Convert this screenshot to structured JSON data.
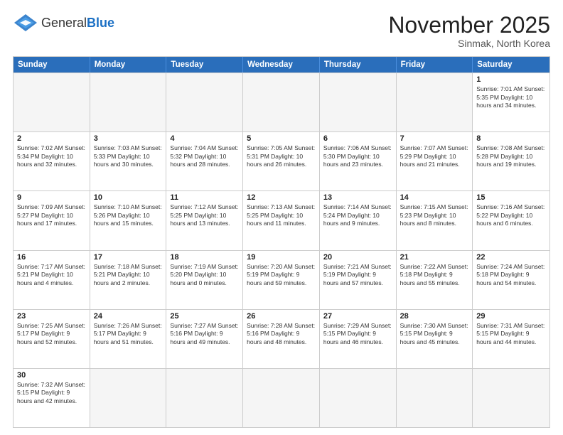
{
  "header": {
    "logo_general": "General",
    "logo_blue": "Blue",
    "month_title": "November 2025",
    "location": "Sinmak, North Korea"
  },
  "days": [
    "Sunday",
    "Monday",
    "Tuesday",
    "Wednesday",
    "Thursday",
    "Friday",
    "Saturday"
  ],
  "weeks": [
    [
      {
        "day": "",
        "info": ""
      },
      {
        "day": "",
        "info": ""
      },
      {
        "day": "",
        "info": ""
      },
      {
        "day": "",
        "info": ""
      },
      {
        "day": "",
        "info": ""
      },
      {
        "day": "",
        "info": ""
      },
      {
        "day": "1",
        "info": "Sunrise: 7:01 AM\nSunset: 5:35 PM\nDaylight: 10 hours and 34 minutes."
      }
    ],
    [
      {
        "day": "2",
        "info": "Sunrise: 7:02 AM\nSunset: 5:34 PM\nDaylight: 10 hours and 32 minutes."
      },
      {
        "day": "3",
        "info": "Sunrise: 7:03 AM\nSunset: 5:33 PM\nDaylight: 10 hours and 30 minutes."
      },
      {
        "day": "4",
        "info": "Sunrise: 7:04 AM\nSunset: 5:32 PM\nDaylight: 10 hours and 28 minutes."
      },
      {
        "day": "5",
        "info": "Sunrise: 7:05 AM\nSunset: 5:31 PM\nDaylight: 10 hours and 26 minutes."
      },
      {
        "day": "6",
        "info": "Sunrise: 7:06 AM\nSunset: 5:30 PM\nDaylight: 10 hours and 23 minutes."
      },
      {
        "day": "7",
        "info": "Sunrise: 7:07 AM\nSunset: 5:29 PM\nDaylight: 10 hours and 21 minutes."
      },
      {
        "day": "8",
        "info": "Sunrise: 7:08 AM\nSunset: 5:28 PM\nDaylight: 10 hours and 19 minutes."
      }
    ],
    [
      {
        "day": "9",
        "info": "Sunrise: 7:09 AM\nSunset: 5:27 PM\nDaylight: 10 hours and 17 minutes."
      },
      {
        "day": "10",
        "info": "Sunrise: 7:10 AM\nSunset: 5:26 PM\nDaylight: 10 hours and 15 minutes."
      },
      {
        "day": "11",
        "info": "Sunrise: 7:12 AM\nSunset: 5:25 PM\nDaylight: 10 hours and 13 minutes."
      },
      {
        "day": "12",
        "info": "Sunrise: 7:13 AM\nSunset: 5:25 PM\nDaylight: 10 hours and 11 minutes."
      },
      {
        "day": "13",
        "info": "Sunrise: 7:14 AM\nSunset: 5:24 PM\nDaylight: 10 hours and 9 minutes."
      },
      {
        "day": "14",
        "info": "Sunrise: 7:15 AM\nSunset: 5:23 PM\nDaylight: 10 hours and 8 minutes."
      },
      {
        "day": "15",
        "info": "Sunrise: 7:16 AM\nSunset: 5:22 PM\nDaylight: 10 hours and 6 minutes."
      }
    ],
    [
      {
        "day": "16",
        "info": "Sunrise: 7:17 AM\nSunset: 5:21 PM\nDaylight: 10 hours and 4 minutes."
      },
      {
        "day": "17",
        "info": "Sunrise: 7:18 AM\nSunset: 5:21 PM\nDaylight: 10 hours and 2 minutes."
      },
      {
        "day": "18",
        "info": "Sunrise: 7:19 AM\nSunset: 5:20 PM\nDaylight: 10 hours and 0 minutes."
      },
      {
        "day": "19",
        "info": "Sunrise: 7:20 AM\nSunset: 5:19 PM\nDaylight: 9 hours and 59 minutes."
      },
      {
        "day": "20",
        "info": "Sunrise: 7:21 AM\nSunset: 5:19 PM\nDaylight: 9 hours and 57 minutes."
      },
      {
        "day": "21",
        "info": "Sunrise: 7:22 AM\nSunset: 5:18 PM\nDaylight: 9 hours and 55 minutes."
      },
      {
        "day": "22",
        "info": "Sunrise: 7:24 AM\nSunset: 5:18 PM\nDaylight: 9 hours and 54 minutes."
      }
    ],
    [
      {
        "day": "23",
        "info": "Sunrise: 7:25 AM\nSunset: 5:17 PM\nDaylight: 9 hours and 52 minutes."
      },
      {
        "day": "24",
        "info": "Sunrise: 7:26 AM\nSunset: 5:17 PM\nDaylight: 9 hours and 51 minutes."
      },
      {
        "day": "25",
        "info": "Sunrise: 7:27 AM\nSunset: 5:16 PM\nDaylight: 9 hours and 49 minutes."
      },
      {
        "day": "26",
        "info": "Sunrise: 7:28 AM\nSunset: 5:16 PM\nDaylight: 9 hours and 48 minutes."
      },
      {
        "day": "27",
        "info": "Sunrise: 7:29 AM\nSunset: 5:15 PM\nDaylight: 9 hours and 46 minutes."
      },
      {
        "day": "28",
        "info": "Sunrise: 7:30 AM\nSunset: 5:15 PM\nDaylight: 9 hours and 45 minutes."
      },
      {
        "day": "29",
        "info": "Sunrise: 7:31 AM\nSunset: 5:15 PM\nDaylight: 9 hours and 44 minutes."
      }
    ],
    [
      {
        "day": "30",
        "info": "Sunrise: 7:32 AM\nSunset: 5:15 PM\nDaylight: 9 hours and 42 minutes."
      },
      {
        "day": "",
        "info": ""
      },
      {
        "day": "",
        "info": ""
      },
      {
        "day": "",
        "info": ""
      },
      {
        "day": "",
        "info": ""
      },
      {
        "day": "",
        "info": ""
      },
      {
        "day": "",
        "info": ""
      }
    ]
  ]
}
